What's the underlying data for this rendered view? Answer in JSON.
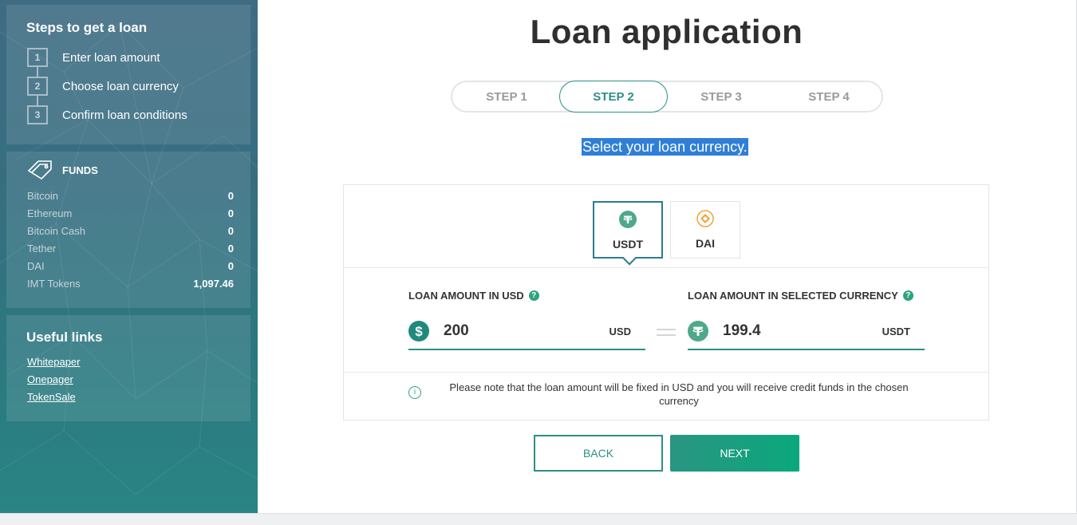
{
  "sidebar": {
    "steps_title": "Steps to get a loan",
    "steps": [
      {
        "num": "1",
        "label": "Enter loan amount"
      },
      {
        "num": "2",
        "label": "Choose loan currency"
      },
      {
        "num": "3",
        "label": "Confirm loan conditions"
      }
    ],
    "funds_title": "FUNDS",
    "funds": [
      {
        "name": "Bitcoin",
        "value": "0"
      },
      {
        "name": "Ethereum",
        "value": "0"
      },
      {
        "name": "Bitcoin Cash",
        "value": "0"
      },
      {
        "name": "Tether",
        "value": "0"
      },
      {
        "name": "DAI",
        "value": "0"
      },
      {
        "name": "IMT Tokens",
        "value": "1,097.46"
      }
    ],
    "links_title": "Useful links",
    "links": [
      "Whitepaper",
      "Onepager",
      "TokenSale"
    ]
  },
  "main": {
    "title": "Loan application",
    "steps": [
      "STEP 1",
      "STEP 2",
      "STEP 3",
      "STEP 4"
    ],
    "active_step": "STEP 2",
    "subtitle": "Select your loan currency.",
    "currencies": [
      {
        "code": "USDT",
        "icon": "tether-icon",
        "selected": true
      },
      {
        "code": "DAI",
        "icon": "dai-icon",
        "selected": false
      }
    ],
    "usd_field": {
      "label": "LOAN AMOUNT IN USD",
      "value": "200",
      "unit": "USD",
      "icon": "dollar-icon"
    },
    "currency_field": {
      "label": "LOAN AMOUNT IN SELECTED CURRENCY",
      "value": "199.4",
      "unit": "USDT",
      "icon": "tether-icon"
    },
    "help_glyph": "?",
    "info_glyph": "i",
    "note": "Please note that the loan amount will be fixed in USD and you will receive credit funds in the chosen currency",
    "back_label": "BACK",
    "next_label": "NEXT"
  },
  "colors": {
    "accent": "#2d8f86",
    "tether_green": "#4fa88a",
    "dai_orange": "#f0a53a",
    "selection_blue": "#2f7fd8"
  }
}
